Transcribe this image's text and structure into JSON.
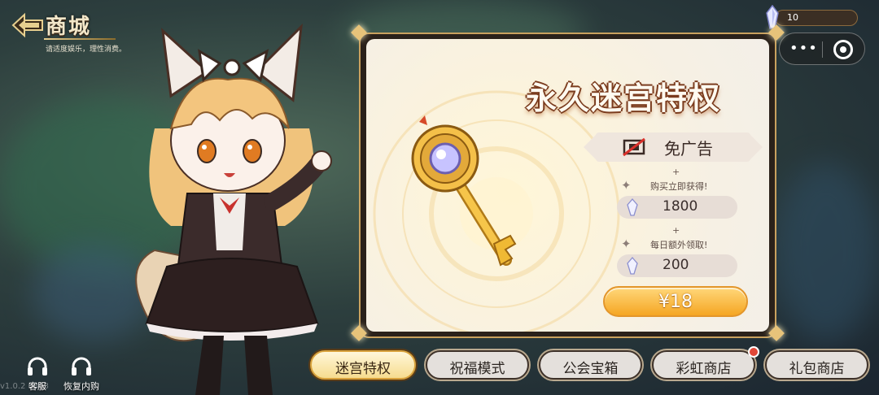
{
  "header": {
    "title": "商城",
    "subtitle": "请适度娱乐，理性消费。"
  },
  "currency": {
    "value": "10"
  },
  "card": {
    "title": "永久迷宫特权",
    "no_ads_label": "免广告",
    "plus1": "+",
    "instant_caption": "购买立即获得!",
    "instant_amount": "1800",
    "plus2": "+",
    "daily_caption": "每日额外领取!",
    "daily_amount": "200",
    "price": "¥18"
  },
  "tabs": [
    {
      "label": "迷宫特权",
      "active": true
    },
    {
      "label": "祝福模式"
    },
    {
      "label": "公会宝箱"
    },
    {
      "label": "彩虹商店"
    },
    {
      "label": "礼包商店"
    }
  ],
  "bottom_left": {
    "customer_service": "客服",
    "restore_purchase": "恢复内购"
  },
  "version": "v1.0.2 0803",
  "colors": {
    "accent": "#f5a623",
    "badge": "#e24838"
  }
}
